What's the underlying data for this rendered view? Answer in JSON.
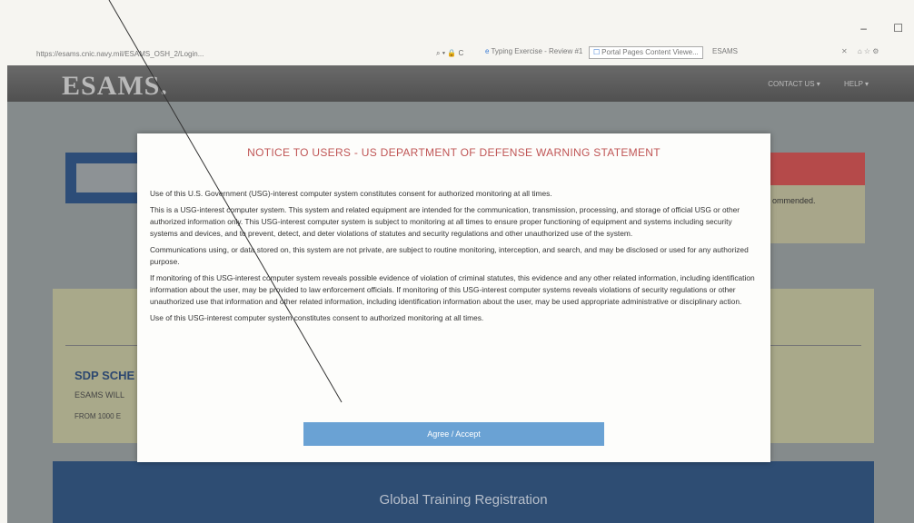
{
  "browser": {
    "window_controls": [
      "–",
      "☐"
    ],
    "url": "https://esams.cnic.navy.mil/ESAMS_OSH_2/Login...",
    "tabs": [
      {
        "label": "Typing Exercise - Review #1"
      },
      {
        "label": "Portal Pages Content Viewe..."
      },
      {
        "label": "ESAMS"
      }
    ]
  },
  "header": {
    "logo": "ESAMS.",
    "nav": [
      "CONTACT US ▾",
      "HELP ▾"
    ]
  },
  "background": {
    "right_notice": "ommended.",
    "sdp_title": "SDP SCHE",
    "sdp_line1": "ESAMS WILL",
    "sdp_line2": "FROM 1000 E",
    "panel_title": "Global Training Registration"
  },
  "modal": {
    "title": "NOTICE TO USERS - US DEPARTMENT OF DEFENSE WARNING STATEMENT",
    "paragraphs": [
      "Use of this U.S. Government (USG)-interest computer system constitutes consent for authorized monitoring at all times.",
      "This is a USG-interest computer system. This system and related equipment are intended for the communication, transmission, processing, and storage of official USG or other authorized information only. This USG-interest computer system is subject to monitoring at all times to ensure proper functioning of equipment and systems including security systems and devices, and to prevent, detect, and deter violations of statutes and security regulations and other unauthorized use of the system.",
      "Communications using, or data stored on, this system are not private, are subject to routine monitoring, interception, and search, and may be disclosed or used for any authorized purpose.",
      "If monitoring of this USG-interest computer system reveals possible evidence of violation of criminal statutes, this evidence and any other related information, including identification information about the user, may be provided to law enforcement officials. If monitoring of this USG-interest computer systems reveals violations of security regulations or other unauthorized use that information and other related information, including identification information about the user, may be used appropriate administrative or disciplinary action.",
      "Use of this USG-interest computer system constitutes consent to authorized monitoring at all times."
    ],
    "agree_label": "Agree / Accept"
  }
}
